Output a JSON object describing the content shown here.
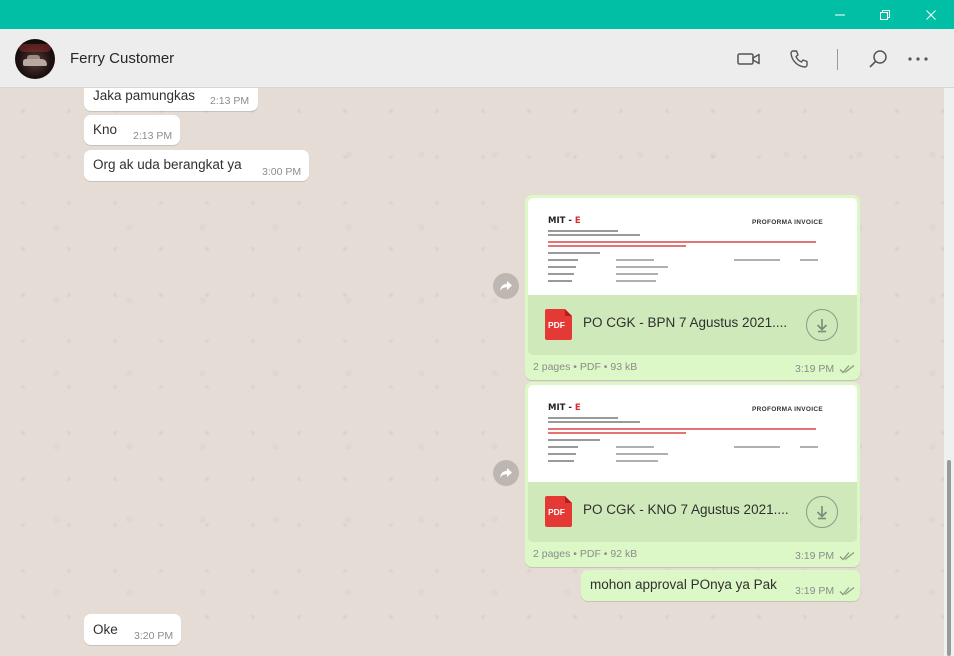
{
  "window": {
    "minimize_icon": "minimize-icon",
    "restore_icon": "restore-icon",
    "close_icon": "close-icon",
    "titlebar_color": "#00bfa5"
  },
  "header": {
    "contact_name": "Ferry Customer",
    "icons": [
      "video-call-icon",
      "voice-call-icon",
      "search-icon",
      "more-options-icon"
    ]
  },
  "messages": [
    {
      "direction": "in",
      "text": "Jaka pamungkas",
      "time": "2:13 PM"
    },
    {
      "direction": "in",
      "text": "Kno",
      "time": "2:13 PM"
    },
    {
      "direction": "in",
      "text": "Org ak uda berangkat ya",
      "time": "3:00 PM"
    },
    {
      "direction": "out",
      "type": "document",
      "file_type_label": "PDF",
      "file_name": "PO CGK - BPN 7 Agustus 2021....",
      "meta": "2 pages • PDF • 93 kB",
      "time": "3:19 PM",
      "preview": {
        "logo_prefix": "MIT - ",
        "logo_suffix": "E",
        "doc_title": "PROFORMA INVOICE"
      }
    },
    {
      "direction": "out",
      "type": "document",
      "file_type_label": "PDF",
      "file_name": "PO CGK - KNO 7 Agustus 2021....",
      "meta": "2 pages • PDF • 92 kB",
      "time": "3:19 PM",
      "preview": {
        "logo_prefix": "MIT - ",
        "logo_suffix": "E",
        "doc_title": "PROFORMA INVOICE"
      }
    },
    {
      "direction": "out",
      "text": "mohon approval POnya ya Pak",
      "time": "3:19 PM"
    },
    {
      "direction": "in",
      "text": "Oke",
      "time": "3:20 PM"
    }
  ],
  "colors": {
    "incoming_bubble": "#ffffff",
    "outgoing_bubble": "#dcf8c6",
    "chat_background": "#e5ddd5",
    "read_ticks": "#8c9a88"
  }
}
